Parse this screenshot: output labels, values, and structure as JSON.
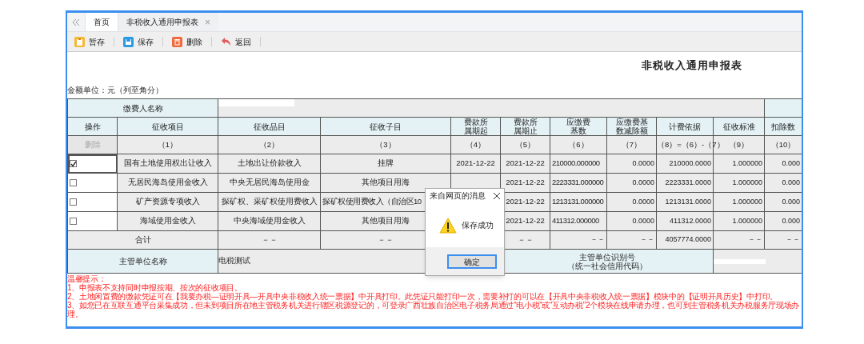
{
  "tabs": [
    {
      "label": "首页",
      "selected": false,
      "closable": false
    },
    {
      "label": "非税收入通用申报表",
      "selected": true,
      "closable": true,
      "close": "×"
    }
  ],
  "toolbar": [
    {
      "label": "暂存",
      "kind": "draft"
    },
    {
      "label": "保存",
      "kind": "save"
    },
    {
      "label": "删除",
      "kind": "delete"
    },
    {
      "label": "返回",
      "kind": "back"
    }
  ],
  "title": "非税收入通用申报表",
  "unit_note": "金额单位：元（列至角分）",
  "payer": {
    "label": "缴费人名称"
  },
  "table": {
    "op_header": "操作",
    "op_button": {
      "label": "删除",
      "disabled": true
    },
    "columns": [
      {
        "label": "征收项目",
        "index": "（1）"
      },
      {
        "label": "征收品目",
        "index": "（2）"
      },
      {
        "label": "征收子目",
        "index": "（3）"
      },
      {
        "label": "费款所属期起",
        "index": "（4）"
      },
      {
        "label": "费款所属期止",
        "index": "（5）"
      },
      {
        "label": "应缴费基数",
        "index": "（6）"
      },
      {
        "label": "应缴费基数减除额",
        "index": "（7）"
      },
      {
        "label": "计费依据",
        "index": "（8）=（6）-（7）"
      },
      {
        "label": "征收标准",
        "index": "（9）"
      },
      {
        "label": "扣除数",
        "index": "（10）"
      }
    ],
    "rows": [
      {
        "checked": true,
        "cells": [
          "国有土地使用权出让收入",
          "土地出让价款收入",
          "挂牌",
          "2021-12-22",
          "2021-12-22",
          "210000.000000",
          "0.0000",
          "210000.0000",
          "1.000000",
          "0.000"
        ]
      },
      {
        "checked": false,
        "cells": [
          "无居民海岛使用金收入",
          "中央无居民海岛使用金",
          "其他项目用海",
          null,
          "2021-12-22",
          "2223331.000000",
          "0.0000",
          "2223331.0000",
          "1.000000",
          "0.000"
        ]
      },
      {
        "checked": false,
        "cells": [
          "矿产资源专项收入",
          "探矿权、采矿权使用费收入",
          "探矿权使用费收入（自治区10",
          null,
          "2021-12-22",
          "1213131.000000",
          "0.0000",
          "1213131.0000",
          "1.000000",
          "0.000"
        ]
      },
      {
        "checked": false,
        "cells": [
          "海域使用金收入",
          "中央海域使用金收入",
          "其他项目用海",
          null,
          "2021-12-22",
          "411312.000000",
          "0.0000",
          "411312.0000",
          "1.000000",
          "0.000"
        ]
      }
    ],
    "total": {
      "label": "合计",
      "cells": [
        "－－",
        "－－",
        null,
        "－－",
        "－－",
        "－－",
        "4057774.0000",
        "－－",
        "－－"
      ]
    }
  },
  "authority": {
    "name_label": "主管单位名称",
    "name_value": "电税测试",
    "id_label_lines": [
      "主管单位识别号",
      "（统一社会信用代码）"
    ]
  },
  "notes": {
    "title": "温馨提示：",
    "lines": [
      "1、申报表不支持同时申报按期、按次的征收项目。",
      "2、土地闲置费的缴款凭证可在【我要办税—证明开具—开具中央非税收入统一票据】中开具打印。此凭证只能打印一次，需要补打的可以在【开具中央非税收入统一票据】模块中的【证明开具历史】中打印。",
      "3、如您已在互联互通平台采集成功，但未到项目所在地主管税务机关进行辖区税源登记的，可登录广西壮族自治区电子税务局通过“电小税”或“互动办税”2个模块在线申请办理，也可到主管税务机关办税服务厅现场办理。"
    ]
  },
  "dialog": {
    "title": "来自网页的消息",
    "message": "保存成功",
    "button": "确定"
  }
}
